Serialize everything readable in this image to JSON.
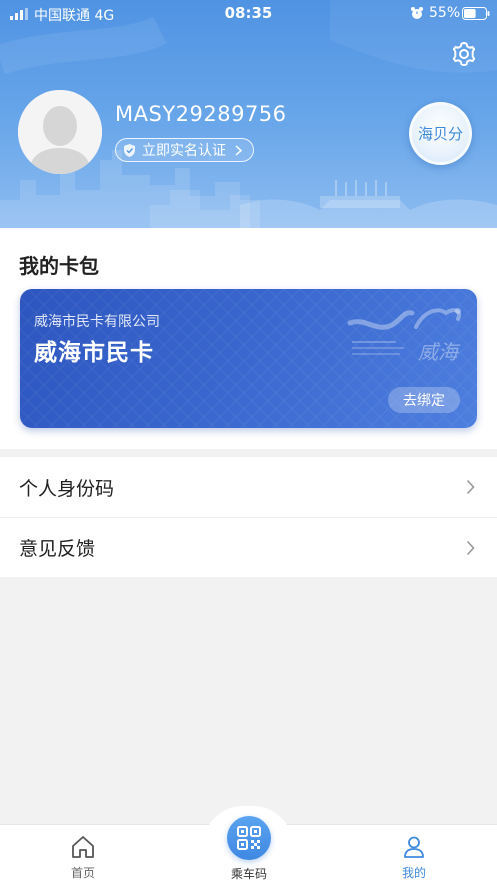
{
  "status_bar": {
    "carrier": "中国联通",
    "network": "4G",
    "time": "08:35",
    "battery_percent": "55%",
    "battery_level": 0.55
  },
  "header": {
    "username": "MASY29289756",
    "verify_label": "立即实名认证",
    "points_label": "海贝分"
  },
  "wallet": {
    "title": "我的卡包",
    "card": {
      "company": "威海市民卡有限公司",
      "name": "威海市民卡",
      "action_label": "去绑定"
    }
  },
  "menu": {
    "items": [
      {
        "label": "个人身份码"
      },
      {
        "label": "意见反馈"
      }
    ]
  },
  "tabbar": {
    "home_label": "首页",
    "ride_label": "乘车码",
    "mine_label": "我的"
  },
  "colors": {
    "header": "#5a9be6",
    "card": "#3a68cf",
    "accent": "#3f8ae0"
  },
  "icons": [
    "signal-icon",
    "alarm-icon",
    "battery-icon",
    "settings-icon",
    "shield-check-icon",
    "chevron-right-icon",
    "home-icon",
    "qr-code-icon",
    "user-icon"
  ]
}
